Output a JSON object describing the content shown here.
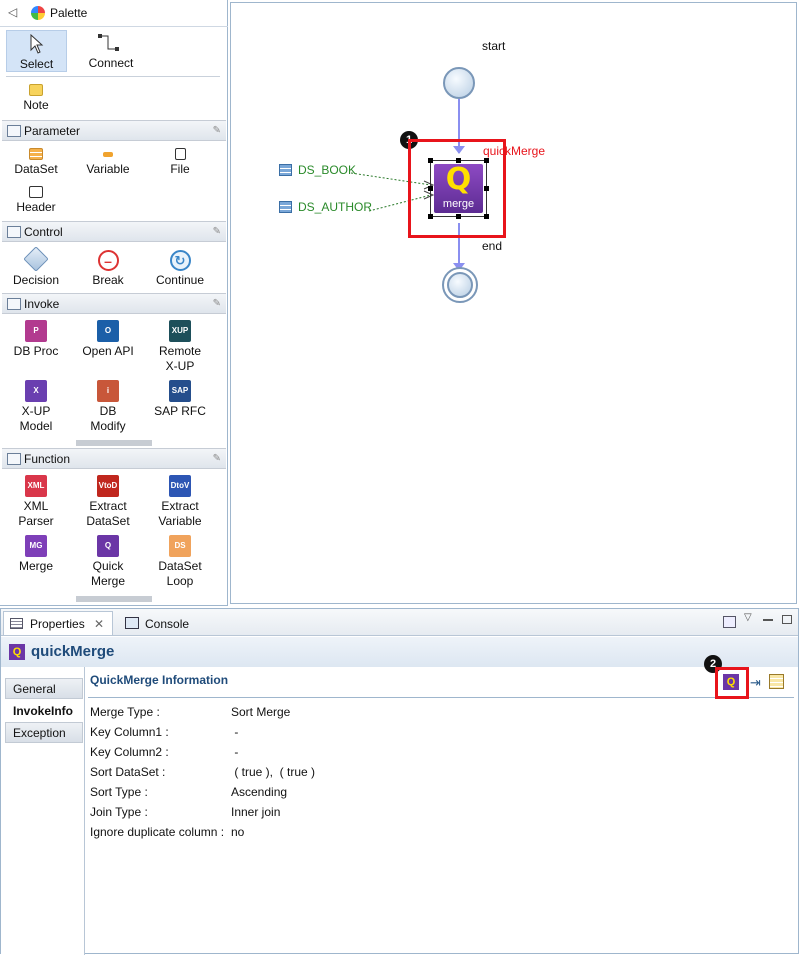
{
  "palette": {
    "title": "Palette",
    "select_label": "Select",
    "connect_label": "Connect",
    "note_label": "Note",
    "drawers": {
      "parameter": {
        "title": "Parameter",
        "items": [
          "DataSet",
          "Variable",
          "File",
          "Header"
        ]
      },
      "control": {
        "title": "Control",
        "items": [
          "Decision",
          "Break",
          "Continue"
        ]
      },
      "invoke": {
        "title": "Invoke",
        "items": [
          {
            "label": "DB Proc",
            "icon_text": "P",
            "color": "#b23a8f"
          },
          {
            "label": "Open API",
            "icon_text": "O",
            "color": "#1b5fa8"
          },
          {
            "label": "Remote\nX-UP",
            "icon_text": "XUP",
            "color": "#1d4f5a"
          },
          {
            "label": "X-UP\nModel",
            "icon_text": "X",
            "color": "#6a3fb0"
          },
          {
            "label": "DB\nModify",
            "icon_text": "i",
            "color": "#c8573a"
          },
          {
            "label": "SAP RFC",
            "icon_text": "SAP",
            "color": "#254e8c"
          }
        ]
      },
      "function": {
        "title": "Function",
        "items": [
          {
            "label": "XML\nParser",
            "icon_text": "XML",
            "color": "#d9364a"
          },
          {
            "label": "Extract\nDataSet",
            "icon_text": "VtoD",
            "color": "#c0271e"
          },
          {
            "label": "Extract\nVariable",
            "icon_text": "DtoV",
            "color": "#2d56b4"
          },
          {
            "label": "Merge",
            "icon_text": "MG",
            "color": "#7e3fb8"
          },
          {
            "label": "Quick\nMerge",
            "icon_text": "Q",
            "color": "#6b36a6"
          },
          {
            "label": "DataSet\nLoop",
            "icon_text": "DS",
            "color": "#f0a35c"
          }
        ]
      }
    }
  },
  "canvas": {
    "start_label": "start",
    "end_label": "end",
    "node_title": "quickMerge",
    "node_icon_text": "Q",
    "node_sub": "merge",
    "inputs": [
      "DS_BOOK",
      "DS_AUTHOR"
    ],
    "badge1": "1",
    "highlight_color": "#e8141b"
  },
  "properties": {
    "tabs": {
      "properties": "Properties",
      "console": "Console"
    },
    "title": "quickMerge",
    "section_title": "QuickMerge Information",
    "side_tabs": [
      "General",
      "InvokeInfo",
      "Exception"
    ],
    "badge2": "2",
    "rows": [
      {
        "label": "Merge Type :",
        "value": "Sort Merge"
      },
      {
        "label": "Key Column1 :",
        "value": " -"
      },
      {
        "label": "Key Column2 :",
        "value": " -"
      },
      {
        "label": "Sort DataSet :",
        "value": " ( true ),  ( true )"
      },
      {
        "label": "Sort Type :",
        "value": "Ascending"
      },
      {
        "label": "Join Type :",
        "value": "Inner join"
      },
      {
        "label": "Ignore duplicate column :",
        "value": "no"
      }
    ]
  }
}
